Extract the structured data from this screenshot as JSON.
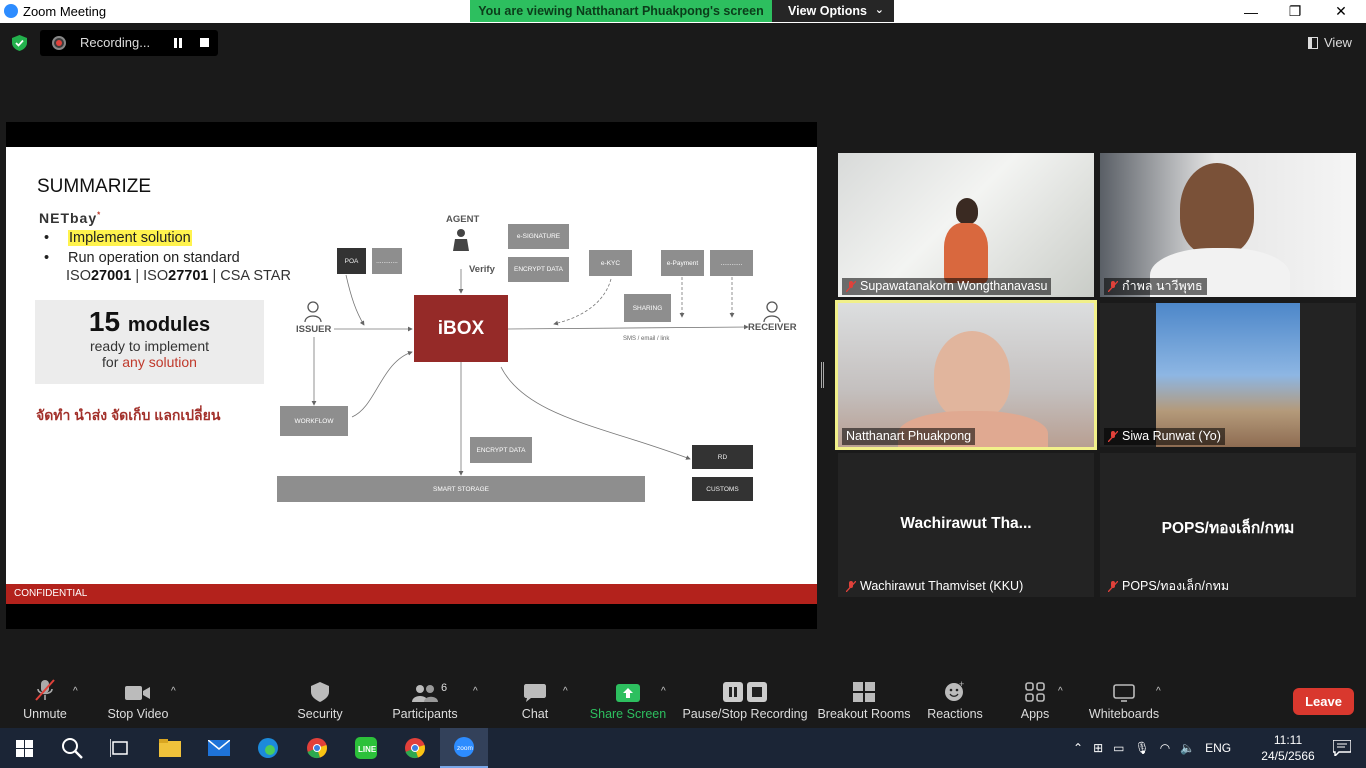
{
  "window": {
    "title": "Zoom Meeting",
    "viewing_banner": "You are viewing Natthanart Phuakpong's screen",
    "view_options": "View Options"
  },
  "recording": {
    "label": "Recording..."
  },
  "view_button": "View",
  "slide": {
    "heading": "SUMMARIZE",
    "logo_text": "NETbay",
    "bullet1": "Implement solution",
    "bullet2": "Run operation on standard",
    "iso_prefix1": "ISO",
    "iso_num1": "27001",
    "iso_sep1": " | ISO",
    "iso_num2": "27701",
    "iso_sep2": " | CSA STAR",
    "modules_num": "15",
    "modules_word": "modules",
    "ready": "ready to implement",
    "for_text": "for ",
    "any_solution": "any solution",
    "thai_line": "จัดทำ นำส่ง จัดเก็บ แลกเปลี่ยน",
    "confidential": "CONFIDENTIAL",
    "diagram": {
      "agent": "AGENT",
      "verify": "Verify",
      "issuer": "ISSUER",
      "receiver": "RECEIVER",
      "ibox": "iBOX",
      "poa": "POA",
      "blank": "............",
      "esig": "e-SIGNATURE",
      "encrypt": "ENCRYPT DATA",
      "ekyc": "e-KYC",
      "epayment": "e-Payment",
      "sharing": "SHARING",
      "sms": "SMS / email / link",
      "workflow": "WORKFLOW",
      "encrypt2": "ENCRYPT DATA",
      "smart_storage": "SMART STORAGE",
      "rd": "RD",
      "customs": "CUSTOMS"
    }
  },
  "participants": [
    {
      "name": "Supawatanakorn Wongthanavasu"
    },
    {
      "name": "กำพล นาวีพุทธ"
    },
    {
      "name": "Natthanart Phuakpong"
    },
    {
      "name": "Siwa Runwat (Yo)"
    },
    {
      "name": "Wachirawut Thamviset (KKU)",
      "display": "Wachirawut  Tha..."
    },
    {
      "name": "POPS/ทองเล็ก/กทม",
      "display": "POPS/ทองเล็ก/กทม"
    }
  ],
  "toolbar": {
    "unmute": "Unmute",
    "stop_video": "Stop Video",
    "security": "Security",
    "participants": "Participants",
    "participants_count": "6",
    "chat": "Chat",
    "share_screen": "Share Screen",
    "pause_stop": "Pause/Stop Recording",
    "breakout": "Breakout Rooms",
    "reactions": "Reactions",
    "apps": "Apps",
    "whiteboards": "Whiteboards",
    "leave": "Leave",
    "share_color": "#2dbf5f",
    "leave_color": "#d9382e"
  },
  "taskbar": {
    "lang": "ENG",
    "time": "11:11",
    "date": "24/5/2566"
  }
}
